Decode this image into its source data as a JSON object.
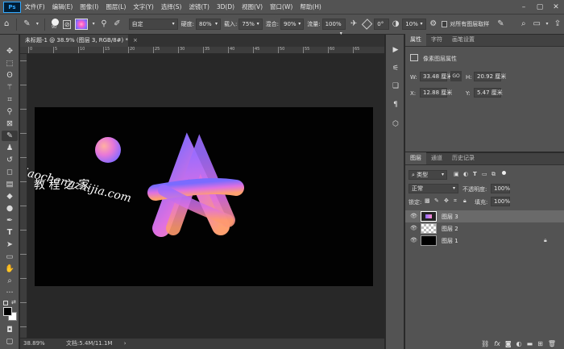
{
  "app": {
    "logo": "Ps"
  },
  "menu": [
    "文件(F)",
    "编辑(E)",
    "图像(I)",
    "图层(L)",
    "文字(Y)",
    "选择(S)",
    "滤镜(T)",
    "3D(D)",
    "视图(V)",
    "窗口(W)",
    "帮助(H)"
  ],
  "window_controls": [
    "–",
    "▢",
    "✕"
  ],
  "options": {
    "brush_size": "90",
    "mode_value": "自定",
    "opacity_label": "硬度:",
    "opacity_value": "80%",
    "flow_label": "载入:",
    "flow_value": "75%",
    "mix_label": "混合:",
    "mix_value": "90%",
    "flow2_label": "流量:",
    "flow2_value": "100%",
    "angle_value": "0°",
    "extra_value": "10%",
    "sample_all_label": "对所有图层取样"
  },
  "document": {
    "tab_title": "未标题-1 @ 38.9% (图层 3, RGB/8#) *",
    "tab_close": "×",
    "status_zoom": "38.89%",
    "status_doc": "文档:5.4M/11.1M",
    "status_arrow": "›"
  },
  "canvas": {
    "art_text": "AI",
    "watermark_line1": "jiaochengzhijia.com",
    "watermark_line2": "教 程 之 家"
  },
  "ruler_ticks": [
    "0",
    "5",
    "10",
    "15",
    "20",
    "25",
    "30",
    "35",
    "40",
    "45",
    "50",
    "55",
    "60",
    "65"
  ],
  "properties": {
    "tabs": [
      "属性",
      "字符",
      "画笔设置"
    ],
    "section_title": "像素图层属性",
    "w_label": "W:",
    "w_value": "33.48 厘米",
    "h_label": "H:",
    "h_value": "20.92 厘米",
    "x_label": "X:",
    "x_value": "12.88 厘米",
    "y_label": "Y:",
    "y_value": "5.47 厘米",
    "link_icon": "GO"
  },
  "layers_panel": {
    "tabs": [
      "图层",
      "通道",
      "历史记录"
    ],
    "filter_kind": "类型",
    "blend_mode": "正常",
    "opacity_label": "不透明度:",
    "opacity_value": "100%",
    "lock_label": "锁定:",
    "fill_label": "填充:",
    "fill_value": "100%",
    "layers": [
      {
        "name": "图层 3",
        "selected": true
      },
      {
        "name": "图层 2",
        "selected": false
      },
      {
        "name": "图层 1",
        "selected": false
      }
    ],
    "bottom_icons": [
      "link-icon",
      "fx-icon",
      "mask-icon",
      "adjustment-icon",
      "folder-icon",
      "new-layer-icon",
      "trash-icon"
    ]
  },
  "colors": {
    "accent": "#31a8ff",
    "ui_bg": "#535353",
    "canvas_bg": "#282828",
    "artboard": "#020202",
    "gradient_start": "#8a6bff",
    "gradient_mid": "#d874e8",
    "gradient_end": "#ff9b6b"
  }
}
